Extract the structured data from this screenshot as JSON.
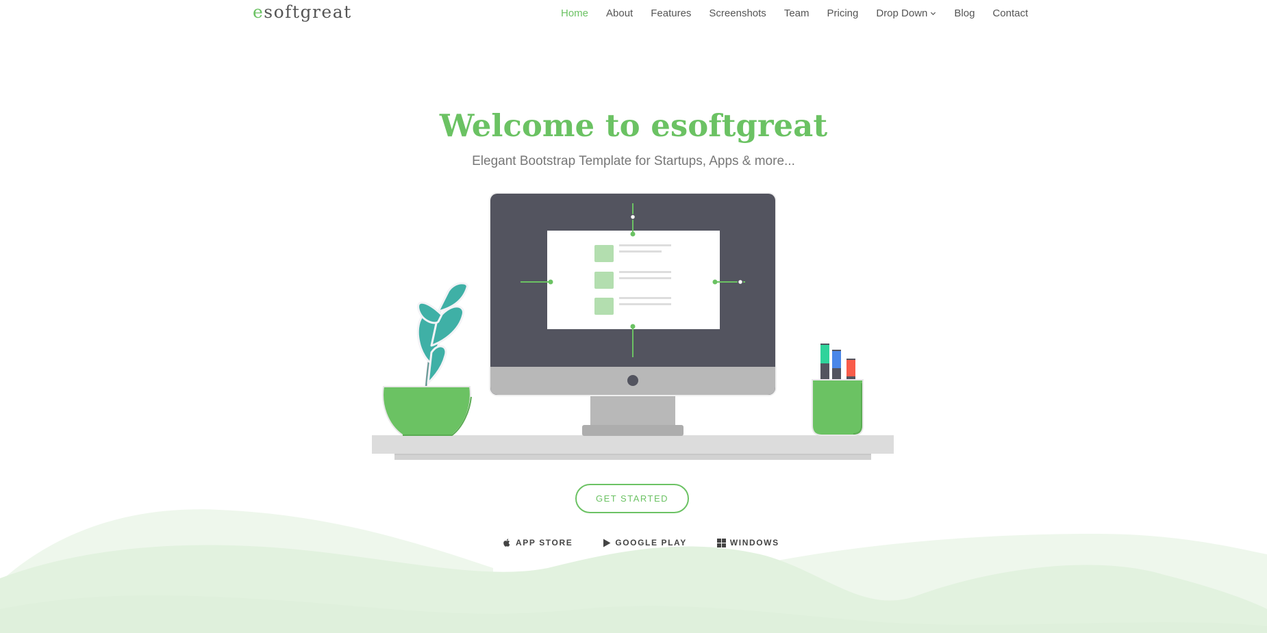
{
  "brand": {
    "logo_first_letter": "e",
    "logo_rest": "softgreat"
  },
  "nav": {
    "items": [
      {
        "label": "Home"
      },
      {
        "label": "About"
      },
      {
        "label": "Features"
      },
      {
        "label": "Screenshots"
      },
      {
        "label": "Team"
      },
      {
        "label": "Pricing"
      },
      {
        "label": "Drop Down"
      },
      {
        "label": "Blog"
      },
      {
        "label": "Contact"
      }
    ],
    "active_index": 0
  },
  "hero": {
    "title": "Welcome to esoftgreat",
    "subtitle": "Elegant Bootstrap Template for Startups, Apps & more..."
  },
  "cta": {
    "label": "GET STARTED"
  },
  "stores": [
    {
      "icon": "apple-icon",
      "label": "APP STORE"
    },
    {
      "icon": "play-icon",
      "label": "GOOGLE PLAY"
    },
    {
      "icon": "windows-icon",
      "label": "WINDOWS"
    }
  ],
  "colors": {
    "accent": "#6bc263",
    "text": "#555555",
    "monitor": "#53545f",
    "wave_light": "#eef7ec",
    "wave_dark": "#e2f2df"
  }
}
